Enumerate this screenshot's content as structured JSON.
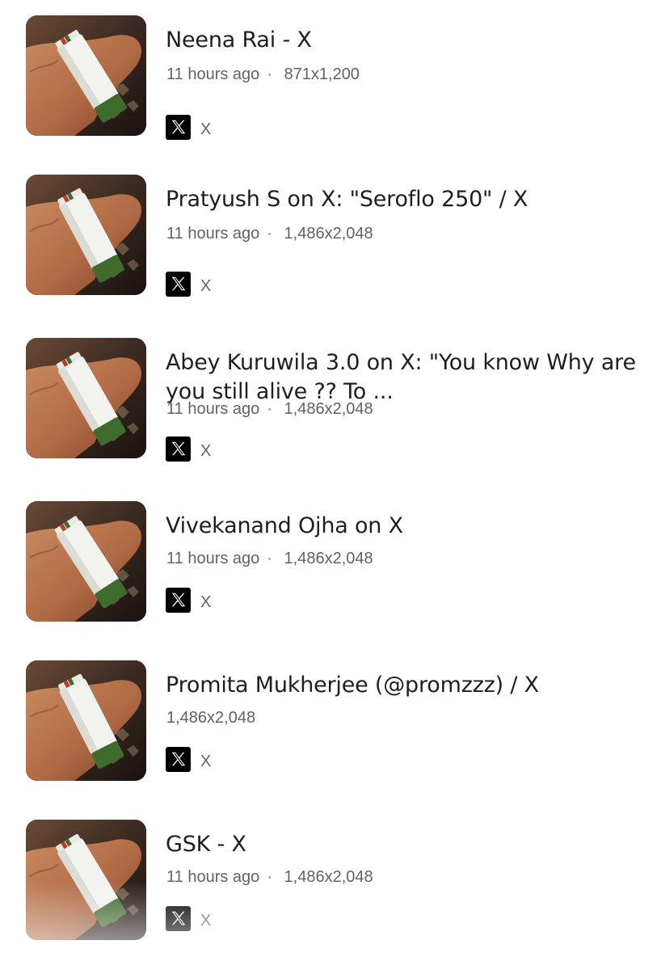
{
  "results": [
    {
      "title": "Neena Rai - X",
      "time": "11 hours ago",
      "dimensions": "871x1,200",
      "source": "X",
      "source_icon": "x-logo-icon"
    },
    {
      "title": "Pratyush S on X: \"Seroflo 250\" / X",
      "time": "11 hours ago",
      "dimensions": "1,486x2,048",
      "source": "X",
      "source_icon": "x-logo-icon"
    },
    {
      "title": "Abey Kuruwila 3.0 on X: \"You know Why are you still alive ?? To ...",
      "time": "11 hours ago",
      "dimensions": "1,486x2,048",
      "source": "X",
      "source_icon": "x-logo-icon"
    },
    {
      "title": "Vivekanand Ojha on X",
      "time": "11 hours ago",
      "dimensions": "1,486x2,048",
      "source": "X",
      "source_icon": "x-logo-icon"
    },
    {
      "title": "Promita Mukherjee (@promzzz) / X",
      "time": "",
      "dimensions": "1,486x2,048",
      "source": "X",
      "source_icon": "x-logo-icon"
    },
    {
      "title": "GSK - X",
      "time": "11 hours ago",
      "dimensions": "1,486x2,048",
      "source": "X",
      "source_icon": "x-logo-icon"
    }
  ],
  "colors": {
    "title": "#1f1f1f",
    "meta": "#5f6368",
    "background": "#ffffff",
    "inhaler_cap": "#3f6b2c"
  }
}
